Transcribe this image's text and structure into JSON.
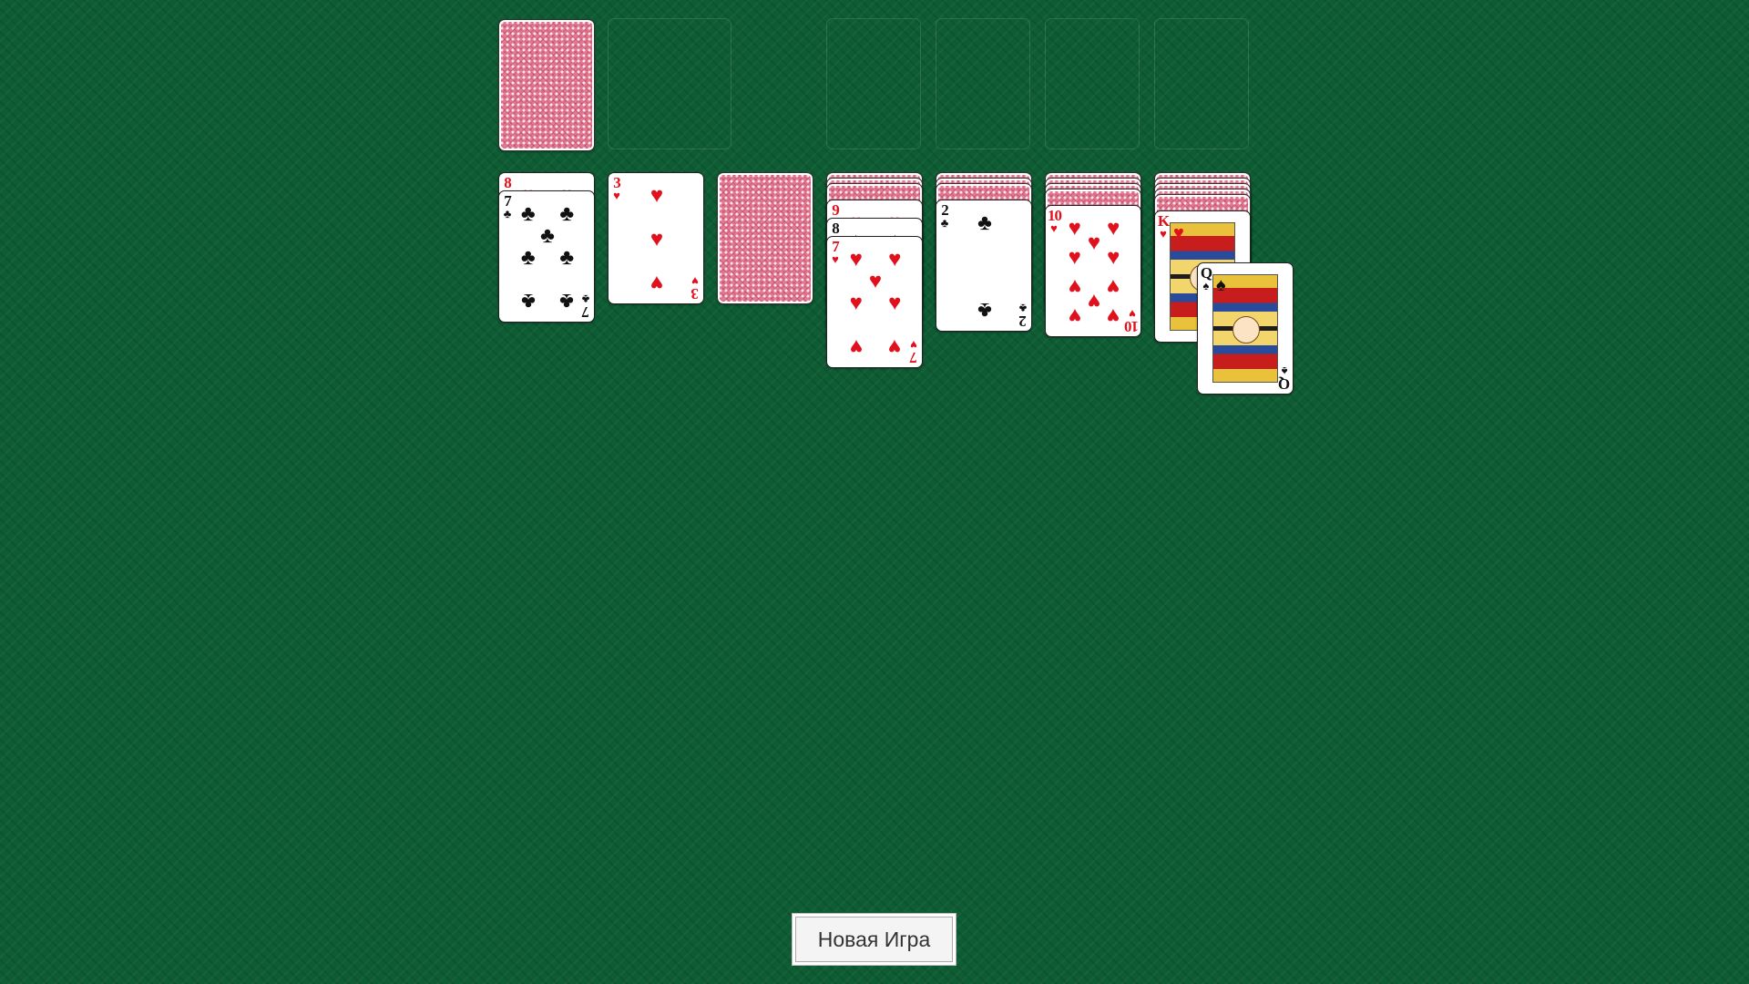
{
  "game": "solitaire",
  "stock": {
    "face_down": true
  },
  "waste": {
    "cards": []
  },
  "foundations": [
    {
      "cards": []
    },
    {
      "cards": []
    },
    {
      "cards": []
    },
    {
      "cards": []
    }
  ],
  "tableau": [
    {
      "cards": [
        {
          "rank": "8",
          "suit": "♥",
          "color": "red",
          "face_up": true
        },
        {
          "rank": "7",
          "suit": "♣",
          "color": "black",
          "face_up": true
        }
      ]
    },
    {
      "cards": [
        {
          "rank": "3",
          "suit": "♥",
          "color": "red",
          "face_up": true
        }
      ]
    },
    {
      "cards": [
        {
          "face_up": false
        }
      ]
    },
    {
      "cards": [
        {
          "face_up": false
        },
        {
          "face_up": false
        },
        {
          "face_up": false
        },
        {
          "rank": "9",
          "suit": "♥",
          "color": "red",
          "face_up": true
        },
        {
          "rank": "8",
          "suit": "♠",
          "color": "black",
          "face_up": true
        },
        {
          "rank": "7",
          "suit": "♥",
          "color": "red",
          "face_up": true
        }
      ]
    },
    {
      "cards": [
        {
          "face_up": false
        },
        {
          "face_up": false
        },
        {
          "face_up": false
        },
        {
          "rank": "2",
          "suit": "♣",
          "color": "black",
          "face_up": true
        }
      ]
    },
    {
      "cards": [
        {
          "face_up": false
        },
        {
          "face_up": false
        },
        {
          "face_up": false
        },
        {
          "face_up": false
        },
        {
          "rank": "10",
          "suit": "♥",
          "color": "red",
          "face_up": true
        }
      ]
    },
    {
      "cards": [
        {
          "face_up": false
        },
        {
          "face_up": false
        },
        {
          "face_up": false
        },
        {
          "face_up": false
        },
        {
          "face_up": false
        },
        {
          "rank": "K",
          "suit": "♥",
          "color": "red",
          "face_up": true
        }
      ]
    }
  ],
  "dragging": {
    "rank": "Q",
    "suit": "♠",
    "color": "black",
    "face_up": true
  },
  "new_game_label": "Новая Игра"
}
